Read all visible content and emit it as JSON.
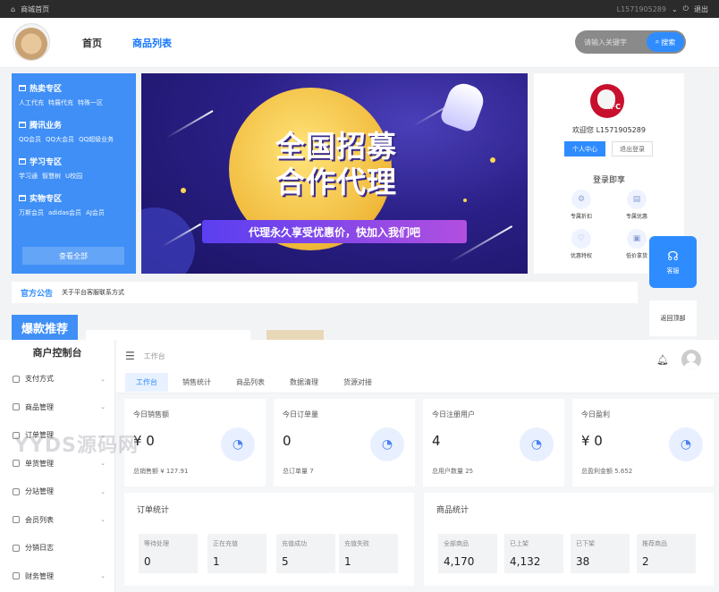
{
  "store": {
    "topbar": {
      "home_link": "商城首页",
      "phone": "L1571905289",
      "logout": "退出"
    },
    "nav": [
      "首页",
      "商品列表"
    ],
    "search": {
      "placeholder": "请输入关键字",
      "button": "搜索"
    },
    "categories": [
      {
        "title": "热卖专区",
        "items": [
          "人工代充",
          "特展代充",
          "特殊一区"
        ]
      },
      {
        "title": "腾讯业务",
        "items": [
          "QQ会员",
          "QQ大会员",
          "QQ超级业务"
        ]
      },
      {
        "title": "学习专区",
        "items": [
          "学习通",
          "智慧树",
          "U校园"
        ]
      },
      {
        "title": "实物专区",
        "items": [
          "万斯会员",
          "adidas会员",
          "AJ会员"
        ]
      }
    ],
    "view_all": "查看全部",
    "banner": {
      "title_line1": "全国招募",
      "title_line2": "合作代理",
      "subtitle": "代理永久享受优惠价，快加入我们吧"
    },
    "user": {
      "welcome": "欢迎您 L1571905289",
      "btn_center": "个人中心",
      "btn_logout": "退出登录",
      "perks_title": "登录即享",
      "perks": [
        {
          "label": "专属折扣",
          "icon": "discount-icon"
        },
        {
          "label": "专属优惠",
          "icon": "gift-icon"
        },
        {
          "label": "优惠特权",
          "icon": "heart-icon"
        },
        {
          "label": "低价拿货",
          "icon": "tag-icon"
        }
      ]
    },
    "float_service": "客服",
    "back_to_top": "返回顶部",
    "notice": {
      "tag": "官方公告",
      "text": "关于平台客服联系方式"
    },
    "hot_label": "爆款推荐"
  },
  "console": {
    "title": "商户控制台",
    "breadcrumb": "工作台",
    "menu": [
      {
        "label": "支付方式",
        "icon": "pay-icon"
      },
      {
        "label": "商品管理",
        "icon": "goods-icon"
      },
      {
        "label": "订单管理",
        "icon": "order-icon"
      },
      {
        "label": "单货管理",
        "icon": "stock-icon"
      },
      {
        "label": "分站管理",
        "icon": "site-icon"
      },
      {
        "label": "会员列表",
        "icon": "user-icon"
      },
      {
        "label": "分销日志",
        "icon": "log-icon"
      },
      {
        "label": "财务管理",
        "icon": "finance-icon"
      }
    ],
    "tabs": [
      "工作台",
      "销售统计",
      "商品列表",
      "数据清理",
      "货源对接"
    ],
    "stats": [
      {
        "label": "今日销售额",
        "value": "¥ 0",
        "foot": "总销售额 ¥ 127.91"
      },
      {
        "label": "今日订单量",
        "value": "0",
        "foot": "总订单量 7"
      },
      {
        "label": "今日注册用户",
        "value": "4",
        "foot": "总用户数量 25"
      },
      {
        "label": "今日盈利",
        "value": "¥ 0",
        "foot": "总盈利金额 5.652"
      }
    ],
    "orders": {
      "title": "订单统计",
      "items": [
        {
          "label": "等待处理",
          "value": "0"
        },
        {
          "label": "正在充值",
          "value": "1"
        },
        {
          "label": "充值成功",
          "value": "5"
        },
        {
          "label": "充值失败",
          "value": "1"
        }
      ]
    },
    "goods": {
      "title": "商品统计",
      "items": [
        {
          "label": "全部商品",
          "value": "4,170"
        },
        {
          "label": "已上架",
          "value": "4,132"
        },
        {
          "label": "已下架",
          "value": "38"
        },
        {
          "label": "推荐商品",
          "value": "2"
        }
      ]
    }
  },
  "watermark": "YYDS源码网"
}
